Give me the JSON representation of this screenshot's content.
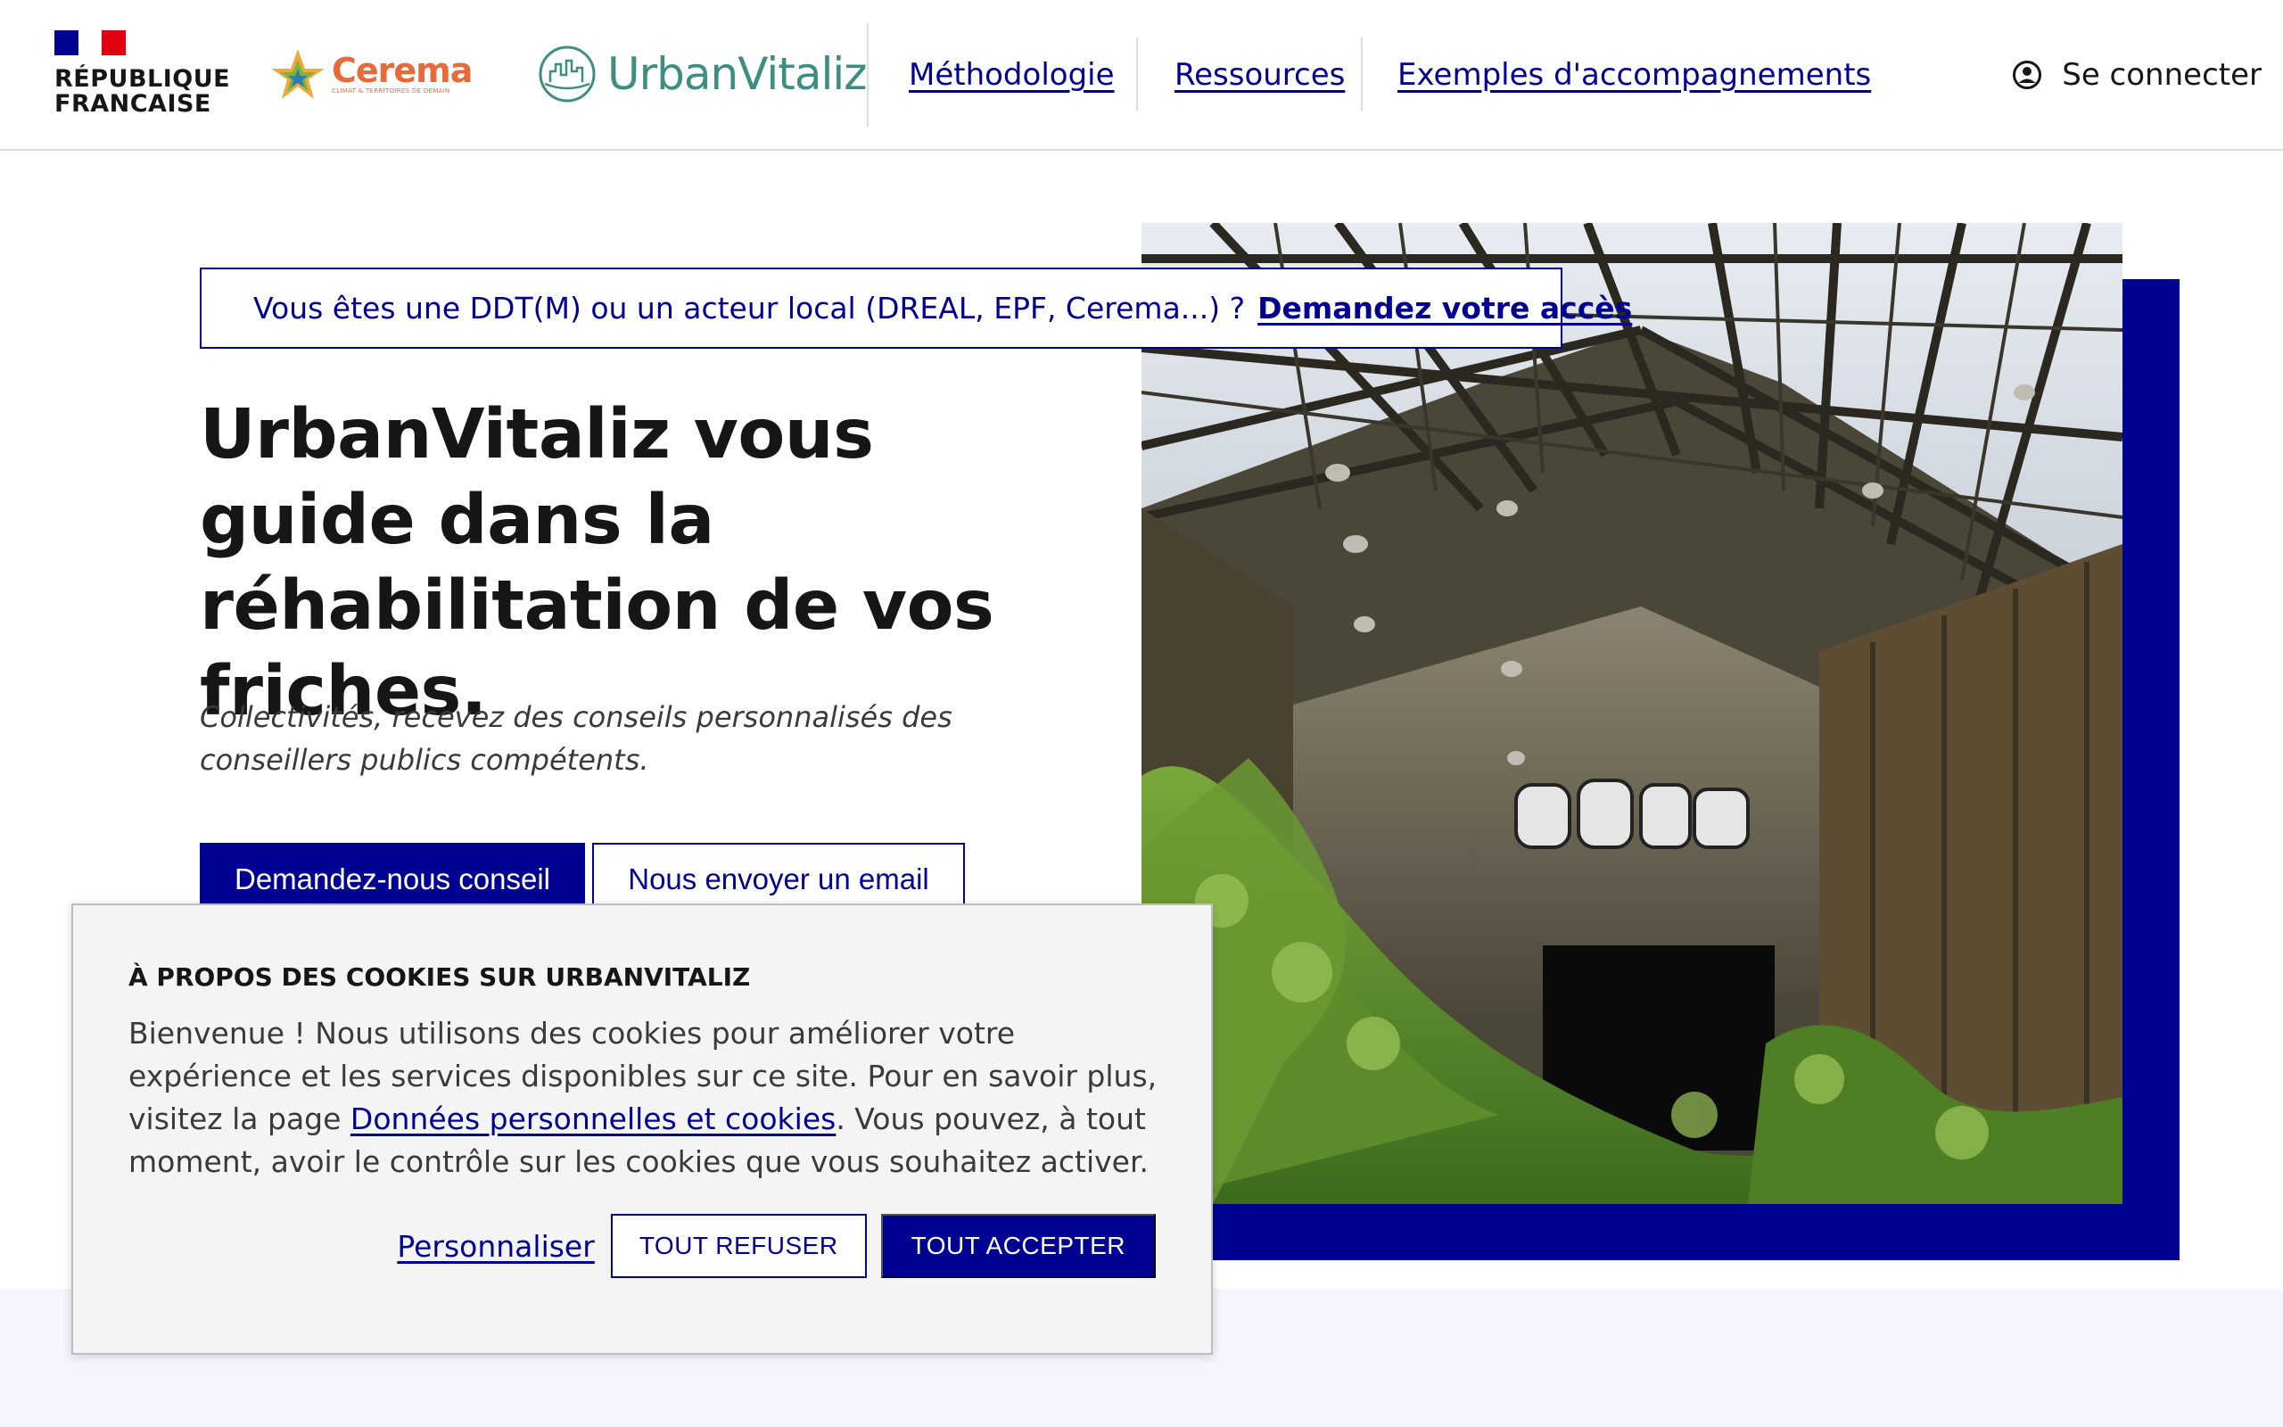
{
  "header": {
    "rf_text_line1": "RÉPUBLIQUE",
    "rf_text_line2": "FRANCAISE",
    "cerema_name": "Cerema",
    "cerema_tagline": "CLIMAT & TERRITOIRES DE DEMAIN",
    "urbanvitaliz_name": "UrbanVitaliz",
    "nav": [
      {
        "label": "Méthodologie"
      },
      {
        "label": "Ressources"
      },
      {
        "label": "Exemples d'accompagnements"
      }
    ],
    "login_label": "Se connecter"
  },
  "banner": {
    "text": "Vous êtes une DDT(M) ou un acteur local (DREAL, EPF, Cerema...) ?",
    "link": "Demandez votre accès",
    "icon": "institution-icon"
  },
  "hero": {
    "title": "UrbanVitaliz vous guide dans la réhabilitation de vos friches.",
    "subtitle": "Collectivités, recevez des conseils personnalisés des conseillers publics compétents.",
    "primary_button": "Demandez-nous conseil",
    "secondary_button": "Nous envoyer un email"
  },
  "cookie": {
    "title": "À PROPOS DES COOKIES SUR URBANVITALIZ",
    "body_before": "Bienvenue ! Nous utilisons des cookies pour améliorer votre expérience et les services disponibles sur ce site. Pour en savoir plus, visitez la page ",
    "body_link": "Données personnelles et cookies",
    "body_after": ". Vous pouvez, à tout moment, avoir le contrôle sur les cookies que vous souhaitez activer.",
    "customize": "Personnaliser",
    "refuse": "TOUT REFUSER",
    "accept": "TOUT ACCEPTER"
  },
  "colors": {
    "accent": "#000091",
    "flag_blue": "#000091",
    "flag_red": "#e1000f",
    "urbanvitaliz_green": "#3e8d83",
    "cerema_orange": "#e86a3a",
    "lower_band": "#f4f4fc"
  }
}
